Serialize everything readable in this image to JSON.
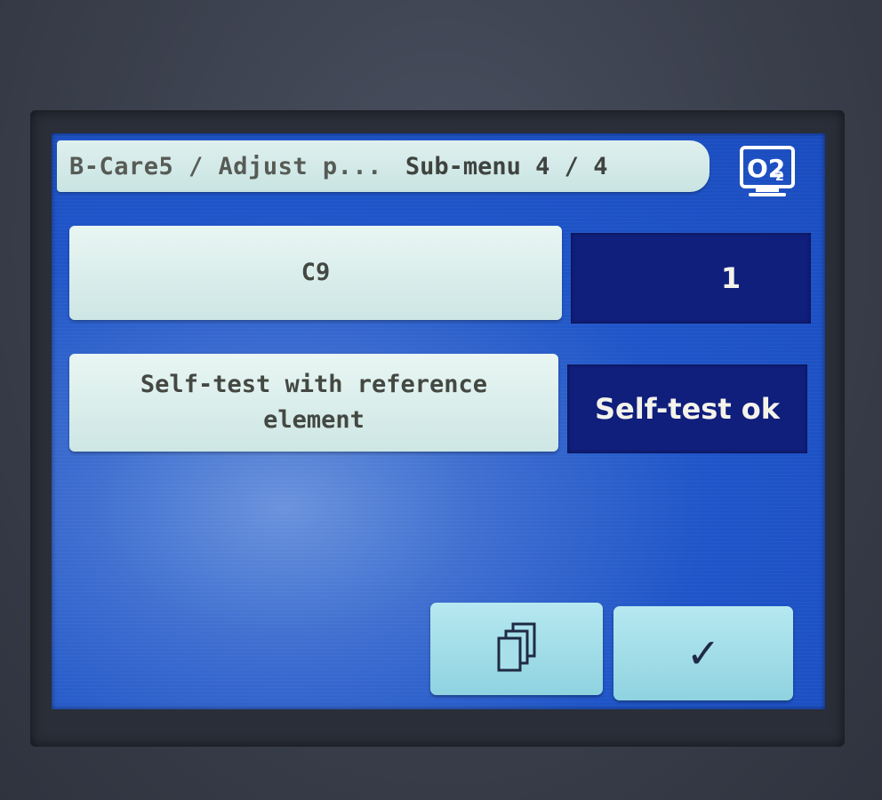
{
  "header": {
    "path": "B-Care5 / Adjust p...",
    "submenu": "Sub-menu 4 / 4",
    "status_icon": "o2-monitor-icon",
    "status_icon_label": "O2"
  },
  "rows": [
    {
      "label": "C9",
      "value": "1"
    },
    {
      "label": "Self-test with reference element",
      "value": "Self-test ok"
    }
  ],
  "buttons": {
    "pages_icon": "pages-icon",
    "confirm_icon": "checkmark-icon",
    "confirm_glyph": "✓"
  },
  "colors": {
    "screen": "#1f55c8",
    "label_bg": "#dff0ee",
    "value_bg": "#101e7c",
    "button_bg": "#a8e0ea"
  }
}
